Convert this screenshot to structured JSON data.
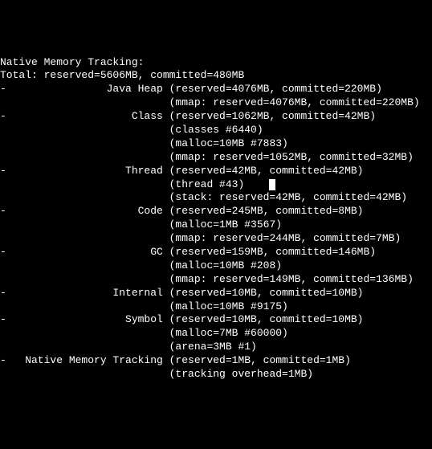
{
  "header": "Native Memory Tracking:",
  "total": "Total: reserved=5606MB, committed=480MB",
  "sections": [
    {
      "name": "Java Heap",
      "main": "(reserved=4076MB, committed=220MB)",
      "details": [
        "(mmap: reserved=4076MB, committed=220MB)"
      ]
    },
    {
      "name": "Class",
      "main": "(reserved=1062MB, committed=42MB)",
      "details": [
        "(classes #6440)",
        "(malloc=10MB #7883)",
        "(mmap: reserved=1052MB, committed=32MB)"
      ]
    },
    {
      "name": "Thread",
      "main": "(reserved=42MB, committed=42MB)",
      "details": [
        "(thread #43)",
        "(stack: reserved=42MB, committed=42MB)"
      ],
      "cursor_after_detail_index": 0
    },
    {
      "name": "Code",
      "main": "(reserved=245MB, committed=8MB)",
      "details": [
        "(malloc=1MB #3567)",
        "(mmap: reserved=244MB, committed=7MB)"
      ]
    },
    {
      "name": "GC",
      "main": "(reserved=159MB, committed=146MB)",
      "details": [
        "(malloc=10MB #208)",
        "(mmap: reserved=149MB, committed=136MB)"
      ]
    },
    {
      "name": "Internal",
      "main": "(reserved=10MB, committed=10MB)",
      "details": [
        "(malloc=10MB #9175)"
      ]
    },
    {
      "name": "Symbol",
      "main": "(reserved=10MB, committed=10MB)",
      "details": [
        "(malloc=7MB #60000)",
        "(arena=3MB #1)"
      ]
    },
    {
      "name": "Native Memory Tracking",
      "main": "(reserved=1MB, committed=1MB)",
      "details": [
        "(tracking overhead=1MB)"
      ]
    }
  ]
}
